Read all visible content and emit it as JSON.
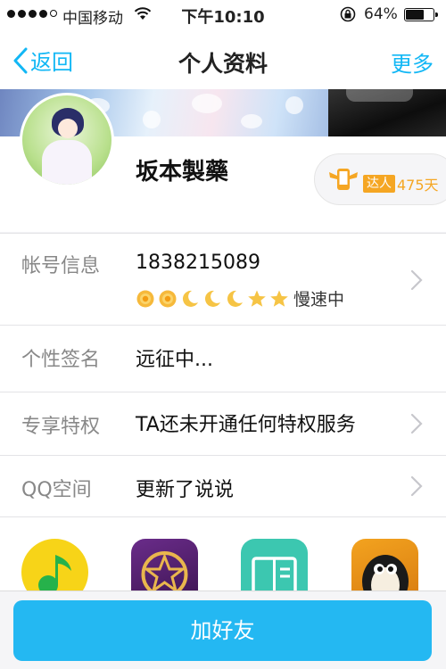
{
  "status_bar": {
    "carrier": "中国移动",
    "time": "下午10:10",
    "battery": "64%",
    "signal_dots_filled": 4,
    "battery_level": 0.64
  },
  "nav": {
    "back_label": "返回",
    "title": "个人资料",
    "more_label": "更多"
  },
  "profile": {
    "name": "坂本製藥",
    "badge_tag": "达人",
    "badge_days": "475天"
  },
  "rows": {
    "account": {
      "label": "帐号信息",
      "value": "1838215089",
      "status": "慢速中"
    },
    "signature": {
      "label": "个性签名",
      "value": "远征中..."
    },
    "privilege": {
      "label": "专享特权",
      "value": "TA还未开通任何特权服务"
    },
    "qzone": {
      "label": "QQ空间",
      "value": "更新了说说"
    }
  },
  "level_icons": [
    "sun-icon",
    "sun-icon",
    "moon-icon",
    "moon-icon",
    "moon-icon",
    "star-icon",
    "star-icon"
  ],
  "apps": [
    "qq-music-icon",
    "star-app-icon",
    "book-app-icon",
    "penguin-app-icon"
  ],
  "bottom": {
    "add_friend_label": "加好友"
  },
  "colors": {
    "accent": "#12b7f5",
    "button": "#24b8f2",
    "badge": "#f5a623"
  }
}
